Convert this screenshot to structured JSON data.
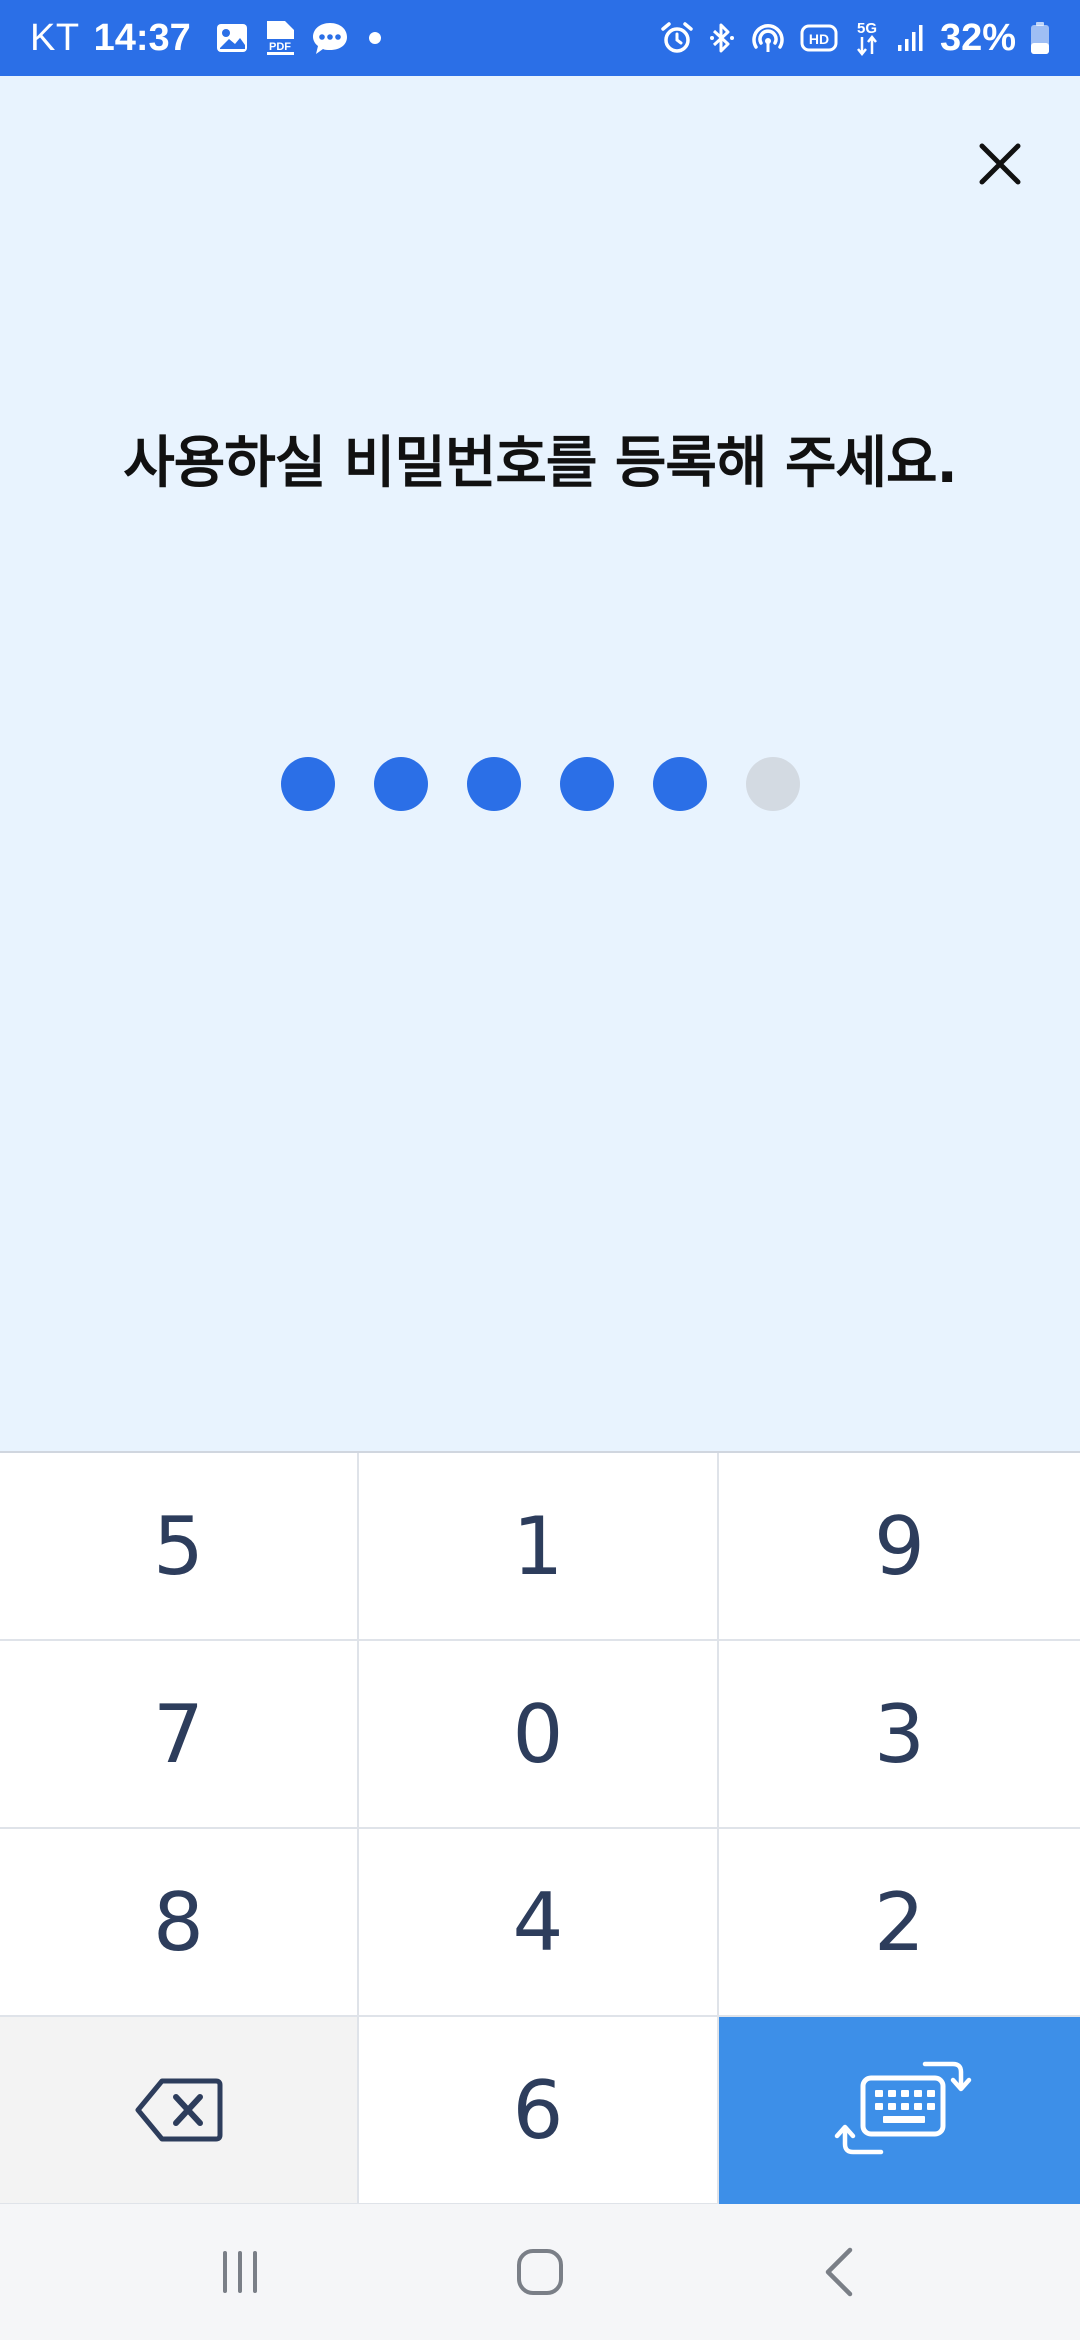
{
  "status_bar": {
    "carrier": "KT",
    "time": "14:37",
    "battery": "32%",
    "left_icons": [
      "image-icon",
      "pdf-icon",
      "chat-bubble-icon",
      "dot-icon"
    ],
    "right_icons": [
      "alarm-icon",
      "bluetooth-icon",
      "hotspot-icon",
      "hd-icon",
      "5g-icon",
      "signal-icon",
      "battery-icon"
    ]
  },
  "main": {
    "close_icon": "close-icon",
    "prompt": "사용하실 비밀번호를 등록해 주세요.",
    "pin_length": 6,
    "pin_filled": 5,
    "colors": {
      "filled_dot": "#2b6fe7",
      "empty_dot": "#d3dae2",
      "background": "#e8f3fe"
    }
  },
  "keypad": {
    "keys": [
      "5",
      "1",
      "9",
      "7",
      "0",
      "3",
      "8",
      "4",
      "2"
    ],
    "bottom_row": {
      "left": "backspace-icon",
      "middle": "6",
      "right": "keyboard-switch-icon"
    },
    "colors": {
      "key_text": "#2d3d5c",
      "switch_bg": "#3d8fe8"
    }
  },
  "navbar": {
    "buttons": [
      "recent-apps-icon",
      "home-icon",
      "back-icon"
    ]
  }
}
